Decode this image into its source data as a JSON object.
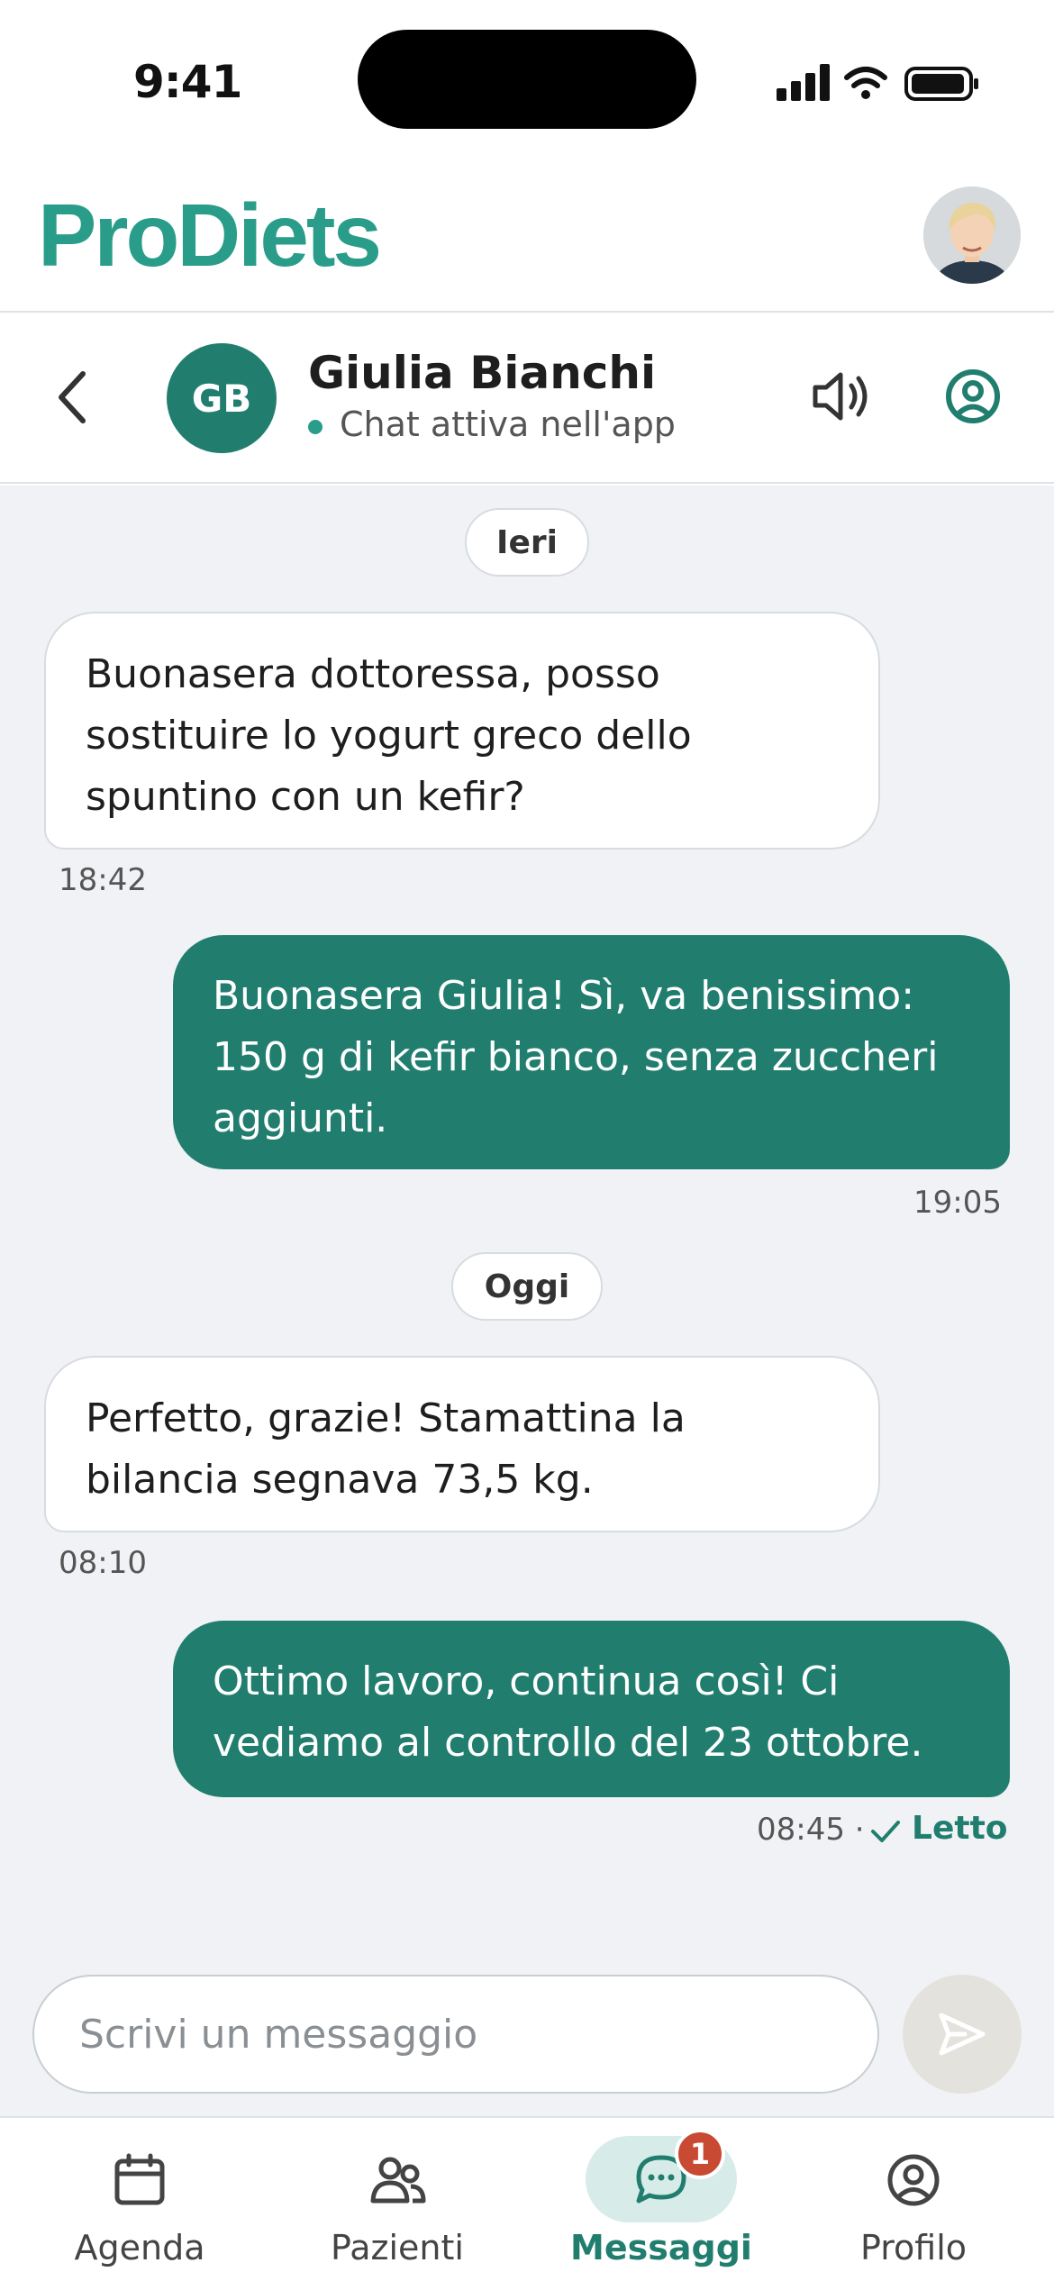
{
  "status_bar": {
    "time": "9:41"
  },
  "app": {
    "logo": "ProDiets"
  },
  "chat_header": {
    "contact_initials": "GB",
    "contact_name": "Giulia Bianchi",
    "contact_status": "Chat attiva nell'app",
    "icons": [
      "chevron-left-icon",
      "speaker-icon",
      "user-circle-icon"
    ]
  },
  "messages": {
    "day1": "Ieri",
    "m1": {
      "text": "Buonasera dottoressa, posso sostituire lo yogurt greco dello spuntino con un kefir?",
      "time": "18:42"
    },
    "m2": {
      "text": "Buonasera Giulia! Sì, va benissimo: 150 g di kefir bianco, senza zuccheri aggiunti.",
      "time": "19:05"
    },
    "day2": "Oggi",
    "m3": {
      "text": "Perfetto, grazie! Stamattina la bilancia segnava 73,5 kg.",
      "time": "08:10"
    },
    "m4": {
      "text": "Ottimo lavoro, continua così! Ci vediamo al controllo del 23 ottobre.",
      "time": "08:45 ·",
      "status": "Letto"
    }
  },
  "composer": {
    "placeholder": "Scrivi un messaggio"
  },
  "tabs": [
    {
      "label": "Agenda",
      "icon": "calendar-icon"
    },
    {
      "label": "Pazienti",
      "icon": "users-icon"
    },
    {
      "label": "Messaggi",
      "icon": "chat-icon",
      "badge": "1",
      "active": true
    },
    {
      "label": "Profilo",
      "icon": "user-circle-icon"
    }
  ],
  "colors": {
    "brand": "#2a9d8a",
    "bubble_out": "#217e6f",
    "badge": "#c94a33"
  }
}
